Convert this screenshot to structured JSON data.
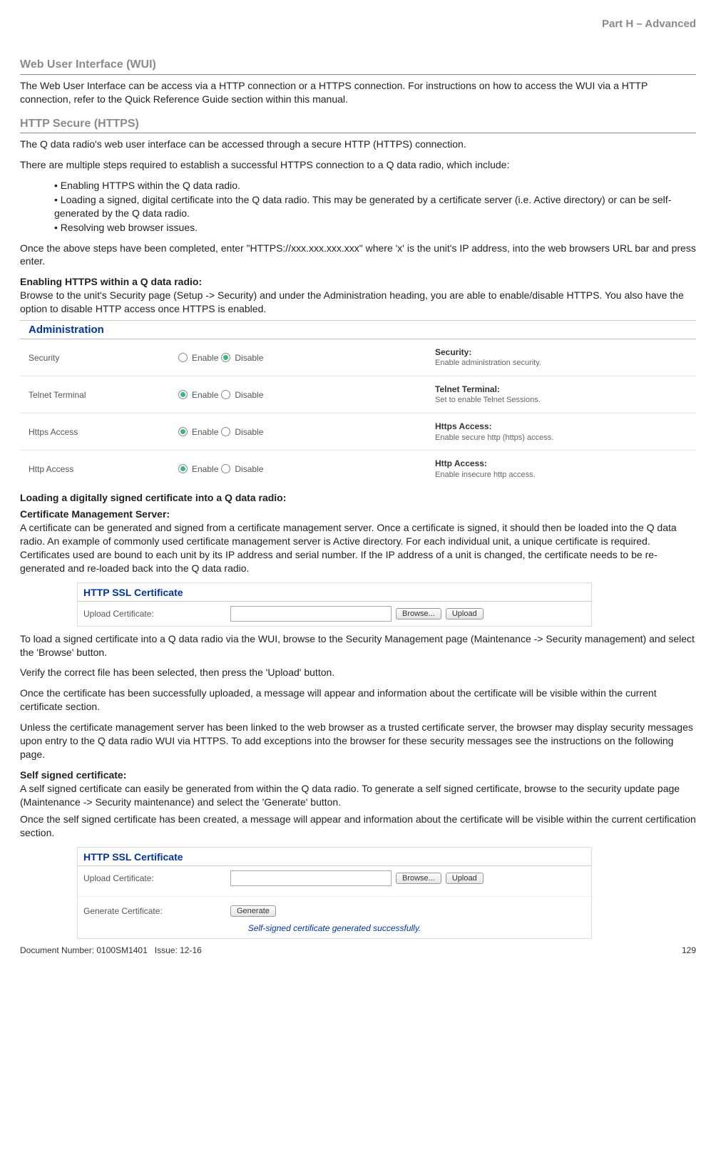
{
  "header": {
    "partTitle": "Part H – Advanced"
  },
  "sections": {
    "wui": {
      "title": "Web User Interface (WUI)",
      "p1": "The Web User Interface can be access via a HTTP connection or a HTTPS connection. For instructions on how to access the WUI via a HTTP connection, refer to the Quick Reference Guide section within this manual."
    },
    "https": {
      "title": "HTTP Secure (HTTPS)",
      "p1": "The Q data radio's web user interface can be accessed through a secure HTTP (HTTPS) connection.",
      "p2": "There are multiple steps required to establish a successful HTTPS connection to a Q data radio, which include:",
      "bullets": [
        "Enabling HTTPS within the Q data radio.",
        "Loading a signed, digital certificate into the Q data radio. This may be generated by a certificate server (i.e. Active directory) or can be self-generated by the Q data radio.",
        "Resolving web browser issues."
      ],
      "p3": "Once the above steps have been completed, enter \"HTTPS://xxx.xxx.xxx.xxx\" where 'x' is the unit's IP address, into the web browsers URL bar and press enter.",
      "enableHeading": "Enabling HTTPS within a Q data radio:",
      "enableBody": "Browse to the unit's Security page (Setup -> Security) and under the Administration heading, you are able to enable/disable HTTPS. You also have the option to disable HTTP access once HTTPS is enabled."
    },
    "admin": {
      "title": "Administration",
      "enable": "Enable",
      "disable": "Disable",
      "rows": [
        {
          "label": "Security",
          "selected": "disable",
          "descTitle": "Security:",
          "descBody": "Enable administration security."
        },
        {
          "label": "Telnet Terminal",
          "selected": "enable",
          "descTitle": "Telnet Terminal:",
          "descBody": "Set to enable Telnet Sessions."
        },
        {
          "label": "Https Access",
          "selected": "enable",
          "descTitle": "Https Access:",
          "descBody": "Enable secure http (https) access."
        },
        {
          "label": "Http Access",
          "selected": "enable",
          "descTitle": "Http Access:",
          "descBody": "Enable insecure http access."
        }
      ]
    },
    "cert": {
      "loadingHeading": "Loading a digitally signed certificate into a Q data radio:",
      "cmsHeading": "Certificate Management Server:",
      "cmsBody": "A certificate can be generated and signed from a certificate management server. Once a certificate is signed, it should then be loaded into the Q data radio. An example of commonly used certificate management server is Active directory. For each individual unit, a unique certificate is required. Certificates used are bound to each unit by its IP address and serial number. If the IP address of a unit is changed, the certificate needs to be re-generated and re-loaded back into the Q data radio.",
      "sslTitle": "HTTP SSL Certificate",
      "uploadLabel": "Upload Certificate:",
      "browseBtn": "Browse...",
      "uploadBtn": "Upload",
      "generateLabel": "Generate Certificate:",
      "generateBtn": "Generate",
      "pLoad": "To load a signed certificate into a Q data radio via the WUI, browse to the Security Management page (Maintenance -> Security management) and select the 'Browse' button.",
      "pVerify": "Verify the correct file has been selected, then press the 'Upload' button.",
      "pUploaded": "Once the certificate has been successfully uploaded, a message will appear and information about the certificate will be visible within the current certificate section.",
      "pUnless": "Unless the certificate management server has been linked to the web browser as a trusted certificate server, the browser may display security messages upon entry to the Q data radio WUI via HTTPS. To add exceptions into the browser for these security messages see the instructions on the following page.",
      "selfHeading": "Self signed certificate:",
      "selfBody": "A self signed certificate can easily be generated from within the Q data radio. To generate a self signed certificate, browse to the security update page (Maintenance -> Security maintenance) and select the 'Generate' button.",
      "selfAfter": "Once the self signed certificate has been created, a message will appear and information about the certificate will be visible within the current certification section.",
      "statusMsg": "Self-signed certificate generated successfully."
    }
  },
  "footer": {
    "docNum": "Document Number: 0100SM1401",
    "issue": "Issue: 12-16",
    "page": "129"
  }
}
